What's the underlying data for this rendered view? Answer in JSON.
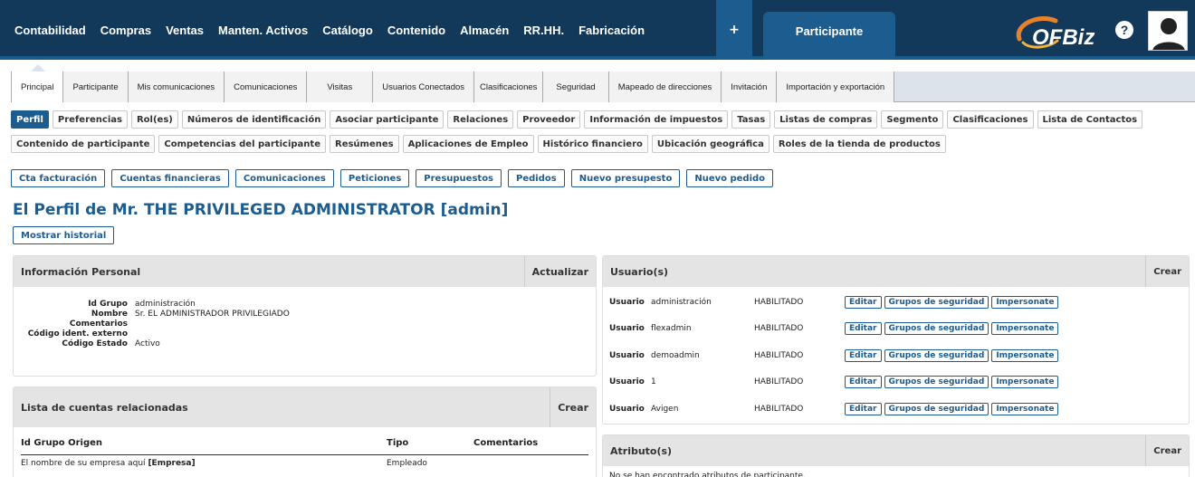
{
  "nav": {
    "items": [
      "Contabilidad",
      "Compras",
      "Ventas",
      "Manten. Activos",
      "Catálogo",
      "Contenido",
      "Almacén",
      "RR.HH.",
      "Fabricación"
    ],
    "plus": "+",
    "app_tab": "Participante",
    "help": "?",
    "logo_text": "OFBiz"
  },
  "subtabs": [
    "Principal",
    "Participante",
    "Mis comunicaciones",
    "Comunicaciones",
    "Visitas",
    "Usuarios Conectados",
    "Clasificaciones",
    "Seguridad",
    "Mapeado de direcciones",
    "Invitación",
    "Importación y exportación"
  ],
  "profile_tabs_row1": [
    "Perfil",
    "Preferencias",
    "Rol(es)",
    "Números de identificación",
    "Asociar participante",
    "Relaciones",
    "Proveedor",
    "Información de impuestos",
    "Tasas",
    "Listas de compras",
    "Segmento",
    "Clasificaciones",
    "Lista de Contactos"
  ],
  "profile_tabs_row2": [
    "Contenido de participante",
    "Competencias del participante",
    "Resúmenes",
    "Aplicaciones de Empleo",
    "Histórico financiero",
    "Ubicación geográfica",
    "Roles de la tienda de productos"
  ],
  "actions": [
    "Cta facturación",
    "Cuentas financieras",
    "Comunicaciones",
    "Peticiones",
    "Presupuestos",
    "Pedidos",
    "Nuevo presupesto",
    "Nuevo pedido"
  ],
  "page_title": "El Perfil de Mr. THE PRIVILEGED ADMINISTRATOR [admin]",
  "history_button": "Mostrar historial",
  "personal": {
    "title": "Información Personal",
    "action": "Actualizar",
    "fields": [
      {
        "label": "Id Grupo",
        "value": "administración"
      },
      {
        "label": "Nombre",
        "value": "Sr. EL ADMINISTRADOR PRIVILEGIADO"
      },
      {
        "label": "Comentarios",
        "value": ""
      },
      {
        "label": "Código ident. externo",
        "value": ""
      },
      {
        "label": "Código Estado",
        "value": "Activo"
      }
    ]
  },
  "related": {
    "title": "Lista de cuentas relacionadas",
    "action": "Crear",
    "headers": [
      "Id Grupo Origen",
      "Tipo",
      "Comentarios"
    ],
    "rows": [
      {
        "origin": "El nombre de su empresa aquí",
        "origin_tag": "[Empresa]",
        "type": "Empleado",
        "comments": ""
      }
    ]
  },
  "users": {
    "title": "Usuario(s)",
    "action": "Crear",
    "row_label": "Usuario",
    "buttons": [
      "Editar",
      "Grupos de seguridad",
      "Impersonate"
    ],
    "rows": [
      {
        "name": "administración",
        "status": "HABILITADO"
      },
      {
        "name": "flexadmin",
        "status": "HABILITADO"
      },
      {
        "name": "demoadmin",
        "status": "HABILITADO"
      },
      {
        "name": "1",
        "status": "HABILITADO"
      },
      {
        "name": "Avigen",
        "status": "HABILITADO"
      }
    ]
  },
  "attributes": {
    "title": "Atributo(s)",
    "action": "Crear",
    "empty": "No se han encontrado atributos de participante."
  },
  "colors": {
    "nav_bg": "#13395a",
    "accent": "#1d5c8f"
  }
}
